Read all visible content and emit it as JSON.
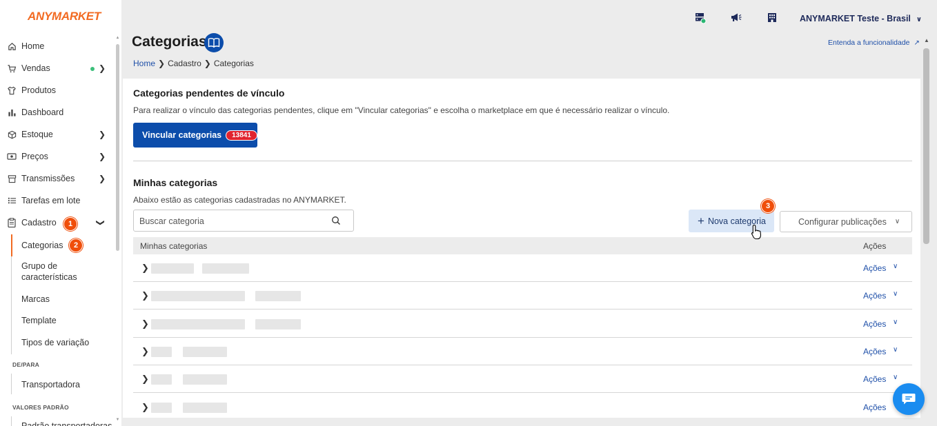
{
  "brand": {
    "logo": "ANYMARKET",
    "accent": "#f26a21",
    "primary": "#0c4dab"
  },
  "sidebar": {
    "items": [
      {
        "label": "Home",
        "icon": "home-icon"
      },
      {
        "label": "Vendas",
        "icon": "cart-icon"
      },
      {
        "label": "Produtos",
        "icon": "shirt-icon"
      },
      {
        "label": "Dashboard",
        "icon": "bar-chart-icon"
      },
      {
        "label": "Estoque",
        "icon": "box-icon"
      },
      {
        "label": "Preços",
        "icon": "money-icon"
      },
      {
        "label": "Transmissões",
        "icon": "store-icon"
      },
      {
        "label": "Tarefas em lote",
        "icon": "list-icon"
      },
      {
        "label": "Cadastro",
        "icon": "clipboard-icon"
      }
    ],
    "cadastro_sub": [
      "Categorias",
      "Grupo de características",
      "Marcas",
      "Template",
      "Tipos de variação"
    ],
    "section_depara": "DE/PARA",
    "depara_sub": [
      "Transportadora"
    ],
    "section_valores": "VALORES PADRÃO",
    "valores_sub": [
      "Padrão transportadoras"
    ],
    "step_badges": [
      "1",
      "2",
      "3"
    ]
  },
  "header": {
    "account": "ANYMARKET Teste - Brasil",
    "icons": [
      "server-check-icon",
      "megaphone-icon",
      "building-icon"
    ]
  },
  "page": {
    "title": "Categorias",
    "breadcrumb": [
      "Home",
      "Cadastro",
      "Categorias"
    ],
    "help_link": "Entenda a funcionalidade"
  },
  "pending": {
    "title": "Categorias pendentes de vínculo",
    "description": "Para realizar o vínculo das categorias pendentes, clique em \"Vincular categorias\" e escolha o marketplace em que é necessário realizar o vínculo.",
    "button_label": "Vincular categorias",
    "count": "13841"
  },
  "mine": {
    "title": "Minhas categorias",
    "description": "Abaixo estão as categorias cadastradas no ANYMARKET.",
    "search_placeholder": "Buscar categoria",
    "new_button": "Nova categoria",
    "config_button": "Configurar publicações",
    "col_name": "Minhas categorias",
    "col_actions": "Ações",
    "rows": [
      {
        "actions": "Ações"
      },
      {
        "actions": "Ações"
      },
      {
        "actions": "Ações"
      },
      {
        "actions": "Ações"
      },
      {
        "actions": "Ações"
      },
      {
        "actions": "Ações"
      }
    ]
  }
}
